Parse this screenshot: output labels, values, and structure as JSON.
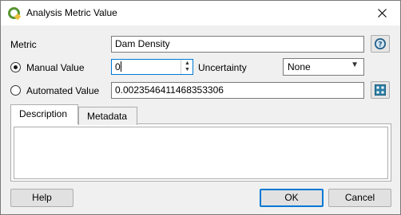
{
  "window": {
    "title": "Analysis Metric Value",
    "app_icon": "qgis-icon",
    "close_icon": "close-icon"
  },
  "form": {
    "metric_label": "Metric",
    "metric_value": "Dam Density",
    "metric_help_icon": "help-icon",
    "manual_label": "Manual Value",
    "manual_selected": true,
    "manual_value": "0",
    "uncertainty_label": "Uncertainty",
    "uncertainty_value": "None",
    "automated_label": "Automated Value",
    "automated_selected": false,
    "automated_value": "0.0023546411468353306",
    "automated_button_icon": "calculator-icon"
  },
  "tabs": [
    {
      "label": "Description",
      "active": true
    },
    {
      "label": "Metadata",
      "active": false
    }
  ],
  "description": {
    "text": ""
  },
  "buttons": {
    "help": "Help",
    "ok": "OK",
    "cancel": "Cancel"
  },
  "colors": {
    "accent": "#0078d4",
    "qgis_green": "#589632",
    "qgis_yellow": "#eebf3e"
  }
}
